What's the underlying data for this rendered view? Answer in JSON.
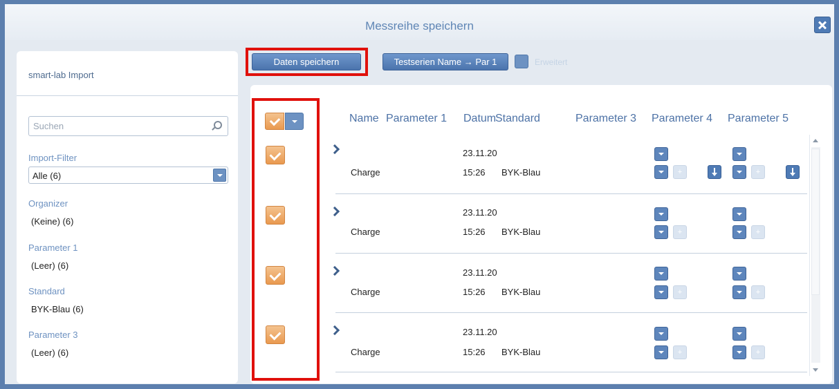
{
  "window": {
    "title": "Messreihe speichern"
  },
  "sidebar": {
    "header": "smart-lab Import",
    "search": {
      "placeholder": "Suchen",
      "value": ""
    },
    "import_filter": {
      "label": "Import-Filter",
      "selected": "Alle (6)"
    },
    "groups": [
      {
        "label": "Organizer",
        "value": "(Keine) (6)"
      },
      {
        "label": "Parameter 1",
        "value": "(Leer) (6)"
      },
      {
        "label": "Standard",
        "value": "BYK-Blau (6)"
      },
      {
        "label": "Parameter 3",
        "value": "(Leer) (6)"
      }
    ]
  },
  "toolbar": {
    "save_label": "Daten speichern",
    "mapping_label": "Testserien Name → Par 1",
    "extended_label": "Erweitert"
  },
  "table": {
    "columns": [
      "Name",
      "Parameter 1",
      "Datum",
      "Standard",
      "Parameter 3",
      "Parameter 4",
      "Parameter 5"
    ],
    "rows": [
      {
        "name": "Charge",
        "date": "23.11.20",
        "time": "15:26",
        "standard": "BYK-Blau",
        "checked": true
      },
      {
        "name": "Charge",
        "date": "23.11.20",
        "time": "15:26",
        "standard": "BYK-Blau",
        "checked": true
      },
      {
        "name": "Charge",
        "date": "23.11.20",
        "time": "15:26",
        "standard": "BYK-Blau",
        "checked": true
      },
      {
        "name": "Charge",
        "date": "23.11.20",
        "time": "15:26",
        "standard": "BYK-Blau",
        "checked": true
      }
    ],
    "plus_glyph": "+"
  },
  "colors": {
    "accent": "#4f7bb5",
    "highlight": "#e0110c",
    "checkbox": "#e9994f"
  }
}
